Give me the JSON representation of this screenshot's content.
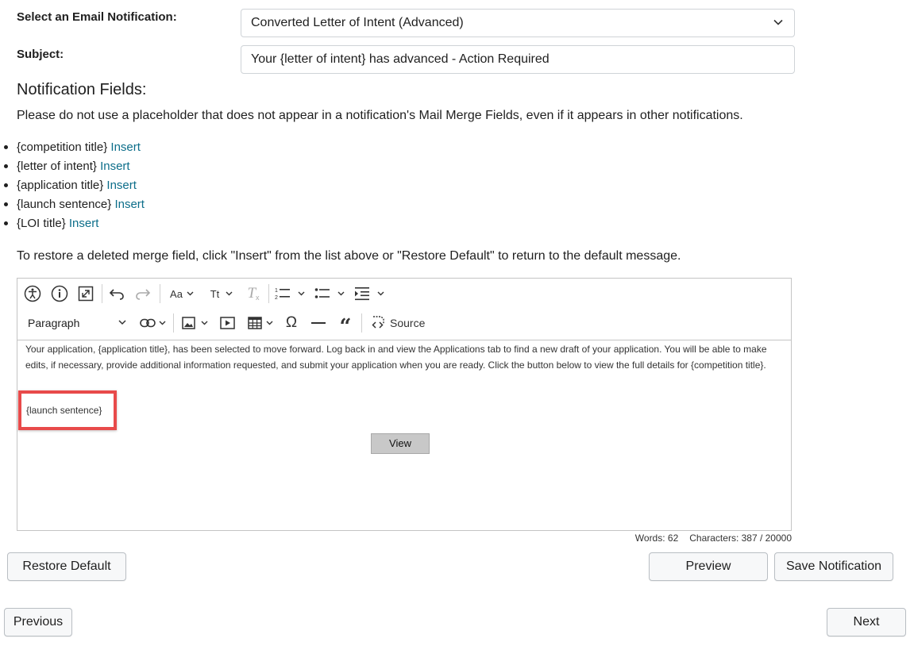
{
  "form": {
    "notification_label": "Select an Email Notification:",
    "notification_value": "Converted Letter of Intent (Advanced)",
    "subject_label": "Subject:",
    "subject_value": "Your {letter of intent} has advanced - Action Required"
  },
  "fields_section": {
    "heading": "Notification Fields:",
    "hint": "Please do not use a placeholder that does not appear in a notification's Mail Merge Fields, even if it appears in other notifications.",
    "insert_label": "Insert",
    "items": [
      {
        "name": "{competition title}"
      },
      {
        "name": "{letter of intent}"
      },
      {
        "name": "{application title}"
      },
      {
        "name": "{launch sentence}"
      },
      {
        "name": "{LOI title}"
      }
    ],
    "restore_hint": "To restore a deleted merge field, click \"Insert\" from the list above or \"Restore Default\" to return to the default message."
  },
  "editor": {
    "toolbar": {
      "paragraph_label": "Paragraph",
      "source_label": "Source",
      "icons": [
        "accessibility-icon",
        "info-icon",
        "fullscreen-icon",
        "undo-icon",
        "redo-icon",
        "font-size-icon",
        "text-transform-icon",
        "remove-format-icon",
        "numbered-list-icon",
        "bulleted-list-icon",
        "indent-icon",
        "link-icon",
        "image-icon",
        "media-icon",
        "table-icon",
        "special-char-icon",
        "horizontal-line-icon",
        "blockquote-icon",
        "source-icon"
      ]
    },
    "body_text": "Your application, {application title}, has been selected to move forward. Log back in and view the Applications tab to find a new draft of your application. You will be able to make edits, if necessary, provide additional information requested, and submit your application when you are ready. Click the button below to view the full details for {competition title}.",
    "launch_sentence": "{launch sentence}",
    "view_button": "View",
    "words": "Words: 62",
    "characters": "Characters: 387 / 20000"
  },
  "actions": {
    "restore_default": "Restore Default",
    "preview": "Preview",
    "save": "Save Notification",
    "previous": "Previous",
    "next": "Next"
  },
  "colors": {
    "link": "#0d6e8a",
    "highlight_border": "#e84a4a"
  }
}
